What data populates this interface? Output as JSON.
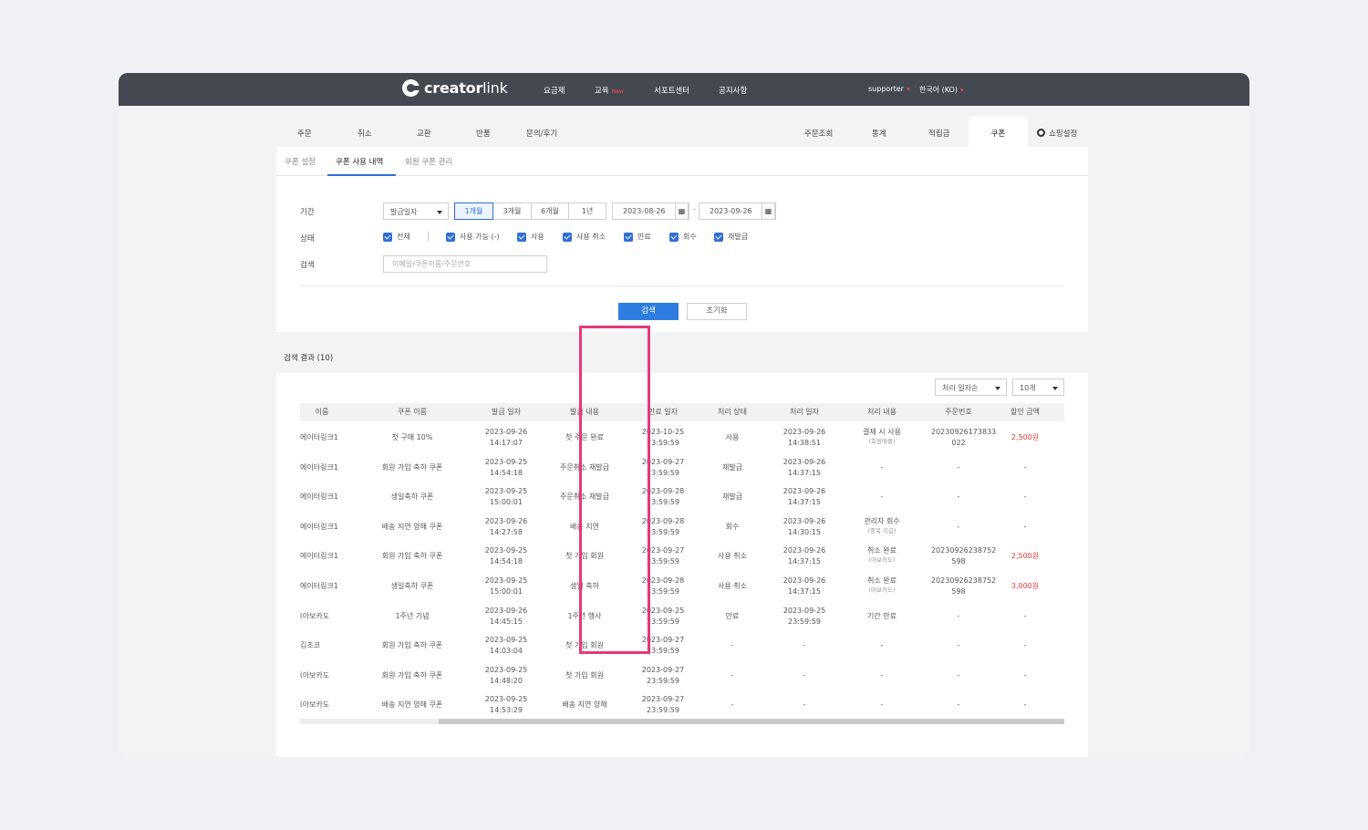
{
  "nav": {
    "brand_bold": "creator",
    "brand_light": "link",
    "items": [
      "요금제",
      "교육",
      "서포트센터",
      "공지사항"
    ],
    "new_badge": "New",
    "user": "supporter",
    "language": "한국어 (KO)"
  },
  "tabs": {
    "left": [
      "주문",
      "취소",
      "교환",
      "반품",
      "문의/후기"
    ],
    "right": [
      "주문조회",
      "통계",
      "적립금",
      "쿠폰"
    ],
    "settings": "쇼핑설정",
    "active": "쿠폰"
  },
  "subtabs": [
    "쿠폰 설정",
    "쿠폰 사용 내역",
    "회원 쿠폰 관리"
  ],
  "filter": {
    "period_label": "기간",
    "status_label": "상태",
    "search_label": "검색",
    "date_type": "발급일자",
    "ranges": [
      "1개월",
      "3개월",
      "6개월",
      "1년"
    ],
    "active_range": "1개월",
    "date_from": "2023-08-26",
    "date_to": "2023-09-26",
    "date_sep": "-",
    "statuses": [
      "전체",
      "사용 가능 (-)",
      "사용",
      "사용 취소",
      "만료",
      "회수",
      "재발급"
    ],
    "search_placeholder": "이메일/쿠폰이름/주문번호",
    "search_button": "검색",
    "reset_button": "초기화"
  },
  "results": {
    "title": "검색 결과 (10)",
    "sort": "처리 일자순",
    "page_size": "10개",
    "columns": [
      "이름",
      "쿠폰 이름",
      "발급 일자",
      "발급 내용",
      "만료 일자",
      "처리 상태",
      "처리 일자",
      "처리 내용",
      "주문번호",
      "할인 금액"
    ],
    "rows": [
      [
        "에이터링크1",
        "첫 구매 10%",
        [
          "2023-09-26",
          "14:17:07"
        ],
        "첫 주문 완료",
        [
          "2023-10-25",
          "23:59:59"
        ],
        "사용",
        [
          "2023-09-26",
          "14:38:51"
        ],
        [
          "결제 시 사용",
          "(회원애플)"
        ],
        [
          "20230926173833",
          "022"
        ],
        "2,500원"
      ],
      [
        "에이터링크1",
        "회원 가입 축하 쿠폰",
        [
          "2023-09-25",
          "14:54:18"
        ],
        "주문취소 재발급",
        [
          "2023-09-27",
          "23:59:59"
        ],
        "재발급",
        [
          "2023-09-26",
          "14:37:15"
        ],
        [
          "-",
          ""
        ],
        [
          "-",
          ""
        ],
        "-"
      ],
      [
        "에이터링크1",
        "생일축하 쿠폰",
        [
          "2023-09-25",
          "15:00:01"
        ],
        "주문취소 재발급",
        [
          "2023-09-28",
          "23:59:59"
        ],
        "재발급",
        [
          "2023-09-26",
          "14:37:15"
        ],
        [
          "-",
          ""
        ],
        [
          "-",
          ""
        ],
        "-"
      ],
      [
        "에이터링크1",
        "배송 지연 양해 쿠폰",
        [
          "2023-09-26",
          "14:27:58"
        ],
        "배송 지연",
        [
          "2023-09-28",
          "23:59:59"
        ],
        "회수",
        [
          "2023-09-26",
          "14:30:15"
        ],
        [
          "관리자 회수",
          "(중복 지급)"
        ],
        [
          "-",
          ""
        ],
        "-"
      ],
      [
        "에이터링크1",
        "회원 가입 축하 쿠폰",
        [
          "2023-09-25",
          "14:54:18"
        ],
        "첫 가입 회원",
        [
          "2023-09-27",
          "23:59:59"
        ],
        "사용 취소",
        [
          "2023-09-26",
          "14:37:15"
        ],
        [
          "취소 완료",
          "(아보카도)"
        ],
        [
          "20230926238752",
          "598"
        ],
        "2,500원"
      ],
      [
        "에이터링크1",
        "생일축하 쿠폰",
        [
          "2023-09-25",
          "15:00:01"
        ],
        "생일 축하",
        [
          "2023-09-28",
          "23:59:59"
        ],
        "사용 취소",
        [
          "2023-09-26",
          "14:37:15"
        ],
        [
          "취소 완료",
          "(아보카도)"
        ],
        [
          "20230926238752",
          "598"
        ],
        "3,000원"
      ],
      [
        "ἰ아보카도",
        "1주년 기념",
        [
          "2023-09-26",
          "14:45:15"
        ],
        "1주년 행사",
        [
          "2023-09-25",
          "23:59:59"
        ],
        "만료",
        [
          "2023-09-25",
          "23:59:59"
        ],
        [
          "기간 만료",
          ""
        ],
        [
          "-",
          ""
        ],
        "-"
      ],
      [
        "김초코",
        "회원 가입 축하 쿠폰",
        [
          "2023-09-25",
          "14:03:04"
        ],
        "첫 가입 회원",
        [
          "2023-09-27",
          "23:59:59"
        ],
        "-",
        [
          "-",
          ""
        ],
        [
          "-",
          ""
        ],
        [
          "-",
          ""
        ],
        "-"
      ],
      [
        "ἰ아보카도",
        "회원 가입 축하 쿠폰",
        [
          "2023-09-25",
          "14:48:20"
        ],
        "첫 가입 회원",
        [
          "2023-09-27",
          "23:59:59"
        ],
        "-",
        [
          "-",
          ""
        ],
        [
          "-",
          ""
        ],
        [
          "-",
          ""
        ],
        "-"
      ],
      [
        "ἰ아보카도",
        "배송 지연 양해 쿠폰",
        [
          "2023-09-25",
          "14:53:29"
        ],
        "배송 지연 양해",
        [
          "2023-09-27",
          "23:59:59"
        ],
        "-",
        [
          "-",
          ""
        ],
        [
          "-",
          ""
        ],
        [
          "-",
          ""
        ],
        "-"
      ]
    ]
  },
  "colors": {
    "accent": "#2f7de1",
    "discount": "#e23a3a",
    "highlight": "#e8377a",
    "nav_bg": "#434851"
  }
}
